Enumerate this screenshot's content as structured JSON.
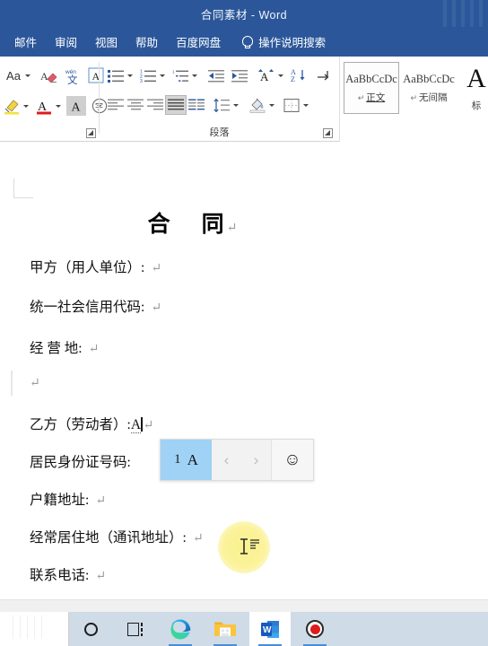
{
  "window": {
    "title": "合同素材  -  Word"
  },
  "ribbon_tabs": [
    {
      "label": "邮件",
      "name": "tab-mailings"
    },
    {
      "label": "审阅",
      "name": "tab-review"
    },
    {
      "label": "视图",
      "name": "tab-view"
    },
    {
      "label": "帮助",
      "name": "tab-help"
    },
    {
      "label": "百度网盘",
      "name": "tab-baidu-netdisk"
    }
  ],
  "tell_me": {
    "label": "操作说明搜索",
    "icon": "lightbulb-icon"
  },
  "font_group": {
    "label": "",
    "row1": [
      {
        "name": "change-case-button",
        "glyph": "Aa",
        "has_caret": true
      },
      {
        "name": "clear-formatting-button",
        "glyph": "clear-format-icon"
      },
      {
        "name": "phonetic-guide-button",
        "glyph": "phonetic-guide-icon"
      },
      {
        "name": "character-border-button",
        "glyph": "character-border-icon"
      }
    ],
    "row2": [
      {
        "name": "text-highlight-color-button",
        "glyph": "highlighter-icon",
        "has_caret": true
      },
      {
        "name": "font-color-button",
        "glyph": "font-color-icon",
        "has_caret": true
      },
      {
        "name": "text-effects-button",
        "glyph": "text-effects-icon"
      },
      {
        "name": "enclose-characters-button",
        "glyph": "enclose-character-icon"
      }
    ]
  },
  "paragraph_group": {
    "label": "段落",
    "row1": [
      {
        "name": "bullets-button",
        "glyph": "bullet-list-icon",
        "has_caret": true
      },
      {
        "name": "numbering-button",
        "glyph": "numbered-list-icon",
        "has_caret": true
      },
      {
        "name": "multilevel-list-button",
        "glyph": "multilevel-list-icon",
        "has_caret": true
      },
      {
        "name": "decrease-indent-button",
        "glyph": "decrease-indent-icon"
      },
      {
        "name": "increase-indent-button",
        "glyph": "increase-indent-icon"
      },
      {
        "name": "text-direction-button",
        "glyph": "text-direction-icon",
        "has_caret": true
      },
      {
        "name": "sort-button",
        "glyph": "sort-az-icon"
      },
      {
        "name": "show-formatting-marks-button",
        "glyph": "pilcrow-icon"
      }
    ],
    "row2": [
      {
        "name": "align-left-button",
        "glyph": "align-left-icon",
        "selected": false
      },
      {
        "name": "align-center-button",
        "glyph": "align-center-icon",
        "selected": false
      },
      {
        "name": "align-right-button",
        "glyph": "align-right-icon",
        "selected": false
      },
      {
        "name": "justify-button",
        "glyph": "justify-icon",
        "selected": true
      },
      {
        "name": "distributed-button",
        "glyph": "distributed-icon",
        "selected": false
      },
      {
        "name": "line-spacing-button",
        "glyph": "line-spacing-icon",
        "has_caret": true
      },
      {
        "name": "shading-button",
        "glyph": "shading-icon",
        "has_caret": true
      },
      {
        "name": "borders-button",
        "glyph": "borders-icon",
        "has_caret": true
      }
    ]
  },
  "style_gallery": [
    {
      "sample": "AaBbCcDc",
      "name": "正文",
      "pilcrow": "↵",
      "active": true
    },
    {
      "sample": "AaBbCcDc",
      "name": "无间隔",
      "pilcrow": "↵",
      "active": false
    },
    {
      "sample": "A",
      "name": "标",
      "pilcrow": "",
      "active": false
    }
  ],
  "document": {
    "title_left": "合",
    "title_right": "同",
    "pilcrow": "↵",
    "lines": [
      {
        "text": "甲方（用人单位）:",
        "mark": "↵"
      },
      {
        "text": "统一社会信用代码:",
        "mark": "↵"
      },
      {
        "text": "经 营 地:",
        "mark": "↵"
      },
      {
        "text": "",
        "mark": "↵"
      },
      {
        "text": "乙方（劳动者）:",
        "composing": "A",
        "mark": "↵"
      },
      {
        "text": "居民身份证号码:",
        "mark": ""
      },
      {
        "text": "户籍地址:",
        "mark": "↵"
      },
      {
        "text": "经常居住地（通讯地址）:",
        "mark": "↵"
      },
      {
        "text": "联系电话:",
        "mark": "↵"
      }
    ]
  },
  "ime": {
    "candidate_index": "1",
    "candidate_value": "A",
    "prev_arrow": "‹",
    "next_arrow": "›",
    "emoji": "☺"
  },
  "taskbar": [
    {
      "name": "taskbar-search-button",
      "icon": "search-circle-icon",
      "active": false
    },
    {
      "name": "taskbar-task-view-button",
      "icon": "task-view-icon",
      "active": false
    },
    {
      "name": "taskbar-edge-button",
      "icon": "edge-icon",
      "active": false,
      "running": true
    },
    {
      "name": "taskbar-file-explorer-button",
      "icon": "folder-icon",
      "active": false,
      "running": true
    },
    {
      "name": "taskbar-word-button",
      "icon": "word-icon",
      "active": true,
      "running": true
    },
    {
      "name": "taskbar-recorder-button",
      "icon": "record-icon",
      "active": false,
      "running": true
    }
  ],
  "colors": {
    "word_blue": "#2b579a",
    "taskbar": "#cfdbe6",
    "ime_highlight": "#9fd2f5",
    "click_halo": "#faf089"
  }
}
